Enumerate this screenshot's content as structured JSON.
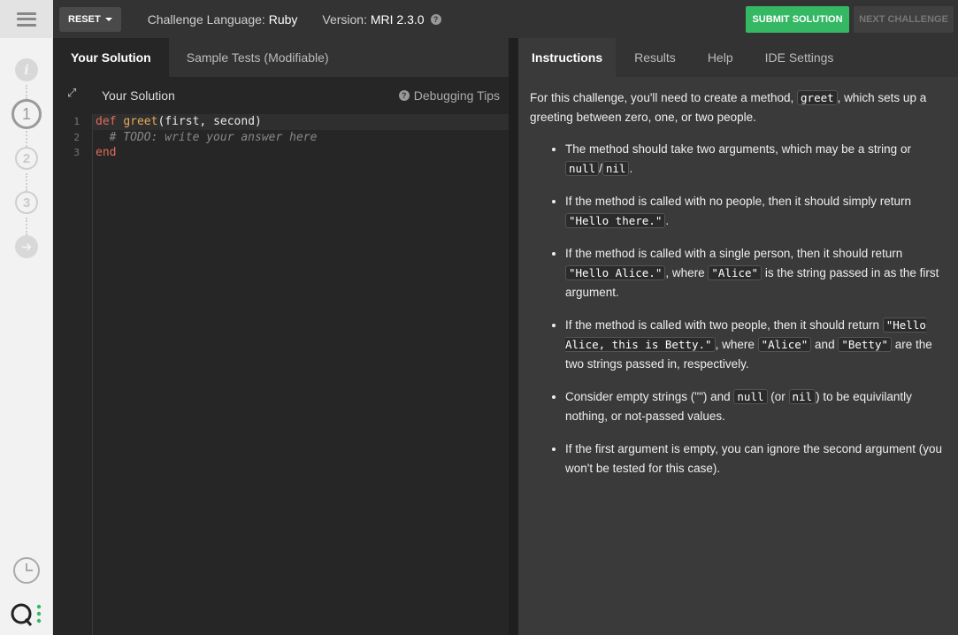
{
  "topbar": {
    "reset_label": "RESET",
    "language_label": "Challenge Language:",
    "language_value": "Ruby",
    "version_label": "Version:",
    "version_value": "MRI 2.3.0",
    "help_glyph": "?",
    "submit_label": "SUBMIT SOLUTION",
    "next_label": "NEXT CHALLENGE"
  },
  "rail": {
    "steps": [
      "i",
      "1",
      "2",
      "3"
    ],
    "colors": {
      "active": "#9a9a9a",
      "inactive": "#cfcfcf"
    }
  },
  "left_tabs": [
    "Your Solution",
    "Sample Tests (Modifiable)"
  ],
  "editor": {
    "title": "Your Solution",
    "debug_label": "Debugging Tips",
    "line_numbers": [
      "1",
      "2",
      "3"
    ],
    "lines": {
      "l1_kw": "def",
      "l1_fn": "greet",
      "l1_rest": "(first, second)",
      "l2_comment": "  # TODO: write your answer here",
      "l3_kw": "end"
    }
  },
  "right_tabs": [
    "Instructions",
    "Results",
    "Help",
    "IDE Settings"
  ],
  "instructions": {
    "intro_pre": "For this challenge, you'll need to create a method, ",
    "intro_code": "greet",
    "intro_post": ", which sets up a greeting between zero, one, or two people.",
    "b1_pre": "The method should take two arguments, which may be a string or ",
    "b1_code1": "null",
    "b1_sep": "/",
    "b1_code2": "nil",
    "b1_post": ".",
    "b2_pre": "If the method is called with no people, then it should simply return ",
    "b2_code": "\"Hello there.\"",
    "b2_post": ".",
    "b3_pre": "If the method is called with a single person, then it should return ",
    "b3_code1": "\"Hello Alice.\"",
    "b3_mid": ", where ",
    "b3_code2": "\"Alice\"",
    "b3_post": " is the string passed in as the first argument.",
    "b4_pre": "If the method is called with two people, then it should return ",
    "b4_code1": "\"Hello Alice, this is Betty.\"",
    "b4_mid1": ", where ",
    "b4_code2": "\"Alice\"",
    "b4_mid2": " and ",
    "b4_code3": "\"Betty\"",
    "b4_post": " are the two strings passed in, respectively.",
    "b5_pre": "Consider empty strings (\"\") and ",
    "b5_code1": "null",
    "b5_mid": " (or ",
    "b5_code2": "nil",
    "b5_post": ") to be equivilantly nothing, or not-passed values.",
    "b6": "If the first argument is empty, you can ignore the second argument (you won't be tested for this case)."
  },
  "accent_colors": {
    "submit": "#35b864",
    "keyword": "#e06c5a",
    "function": "#e5a85a"
  }
}
